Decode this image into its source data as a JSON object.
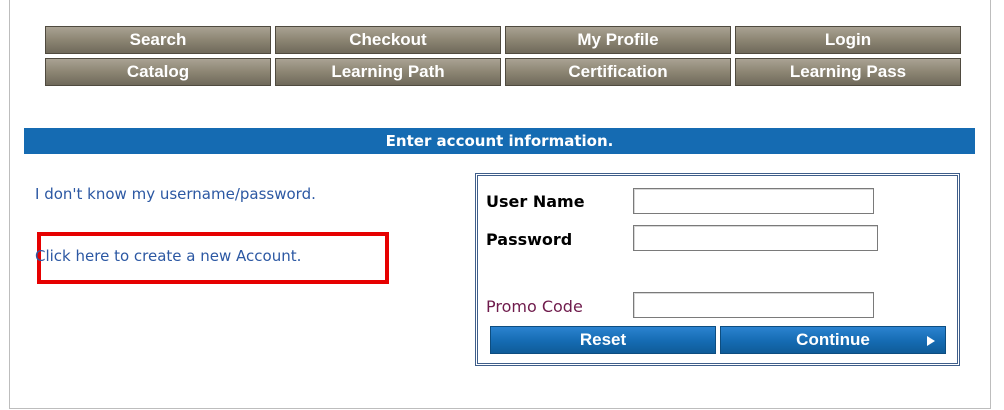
{
  "nav": {
    "row1": [
      "Search",
      "Checkout",
      "My Profile",
      "Login"
    ],
    "row2": [
      "Catalog",
      "Learning Path",
      "Certification",
      "Learning Pass"
    ]
  },
  "banner": {
    "text": "Enter account information."
  },
  "links": {
    "forgot": "I don't know my username/password.",
    "create": "Click here to create a new Account."
  },
  "form": {
    "username_label": "User Name",
    "password_label": "Password",
    "promo_label": "Promo Code",
    "username_value": "",
    "password_value": "",
    "promo_value": "",
    "reset_label": "Reset",
    "continue_label": "Continue",
    "continue_icon": "play-arrow-icon"
  },
  "colors": {
    "nav_button": "#8f8876",
    "banner": "#156bb2",
    "link": "#2c58a3",
    "highlight": "#e60000",
    "action_button": "#156bb2"
  }
}
